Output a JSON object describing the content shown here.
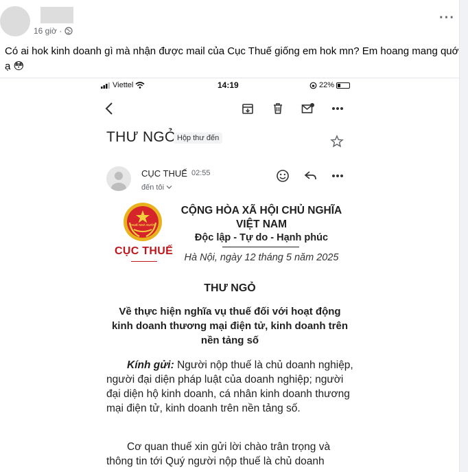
{
  "post": {
    "time": "16 giờ ·",
    "text": "Có ai hok kinh doanh gì mà nhận được mail của Cục Thuế giống em hok mn? Em hoang mang quớ ạ 😳"
  },
  "phone": {
    "carrier": "Viettel",
    "time": "14:19",
    "battery": "22%",
    "battery_level": 0.22
  },
  "email": {
    "subject": "THƯ NGỎ",
    "label": "Hộp thư đến",
    "sender_name": "CỤC THUẾ",
    "sender_time": "02:55",
    "recipient": "đến tôi"
  },
  "letter": {
    "emblem_text": "THUẾ NHÀ NƯỚC",
    "brand": "CỤC THUẾ",
    "national_line1": "CỘNG HÒA XÃ HỘI CHỦ NGHĨA",
    "national_line2": "VIỆT NAM",
    "motto": "Độc lập - Tự do - Hạnh phúc",
    "date": "Hà Nội, ngày 12 tháng 5 năm 2025",
    "title": "THƯ NGỎ",
    "subtitle": "Về thực hiện nghĩa vụ thuế đối với hoạt động kinh doanh thương mại điện tử, kinh doanh trên nền tảng số",
    "greeting_label": "Kính gửi:",
    "greeting_body": "Người nộp thuế là chủ doanh nghiệp, người đại diện pháp luật của doanh nghiệp; người đại diện hộ kinh doanh, cá nhân kinh doanh thương mại điện tử, kinh doanh trên nền tảng số.",
    "para2": "Cơ quan thuế xin gửi lời chào trân trọng và thông tin tới Quý người nộp thuế là chủ doanh"
  },
  "colors": {
    "brand_red": "#c0161b",
    "emblem_red": "#d6252a",
    "emblem_gold": "#e8b21c"
  }
}
